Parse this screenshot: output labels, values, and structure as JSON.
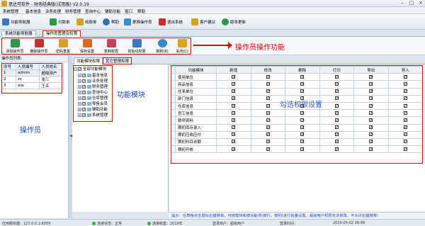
{
  "window": {
    "title": "意达可软件 - 财务经典版(试用版) V2.0.19"
  },
  "menu": [
    "系统管理",
    "基本信息",
    "业务处理",
    "财务管理",
    "查询中心",
    "辅助功能",
    "窗口",
    "帮助"
  ],
  "toolbar": [
    {
      "label": "功能导航器",
      "icon": "navigator-icon",
      "color": "#3a78c8"
    },
    {
      "label": "付款单",
      "icon": "payment-icon",
      "color": "#2d9a4a"
    },
    {
      "label": "收款单",
      "icon": "receipt-icon",
      "color": "#d8a020"
    },
    {
      "label": "帮助",
      "icon": "help-icon",
      "color": "#2f6fc0"
    },
    {
      "label": "更换操作员",
      "icon": "switch-user-icon",
      "color": "#3a8ad8"
    },
    {
      "label": "退出系统",
      "icon": "exit-icon",
      "color": "#c83030"
    },
    {
      "label": "客户建议",
      "icon": "suggestion-icon",
      "color": "#d8a020"
    },
    {
      "label": "版本更新",
      "icon": "update-icon",
      "color": "#2d9a4a"
    }
  ],
  "doc_tabs": [
    "系统功能导航器",
    "操作员管理及权限"
  ],
  "op_buttons": [
    {
      "label": "添加操作员",
      "icon": "add-user-icon",
      "color": "#2d9a4a"
    },
    {
      "label": "删除操作员",
      "icon": "delete-user-icon",
      "color": "#c83030"
    },
    {
      "label": "密码重置",
      "icon": "key-icon",
      "color": "#d8a020"
    },
    {
      "label": "保存设置",
      "icon": "save-icon",
      "color": "#d86a20"
    },
    {
      "label": "复制权限",
      "icon": "copy-permission-icon",
      "color": "#c84060"
    },
    {
      "label": "初始化权限",
      "icon": "init-permission-icon",
      "color": "#3a78c8"
    },
    {
      "label": "刷新(R)",
      "icon": "refresh-icon",
      "color": "#2f8ad0"
    },
    {
      "label": "关闭(C)",
      "icon": "close-icon",
      "color": "#e0a020"
    }
  ],
  "annotations": {
    "op_features": "操作员操作功能",
    "operators": "操作员",
    "modules": "功能模块",
    "permissions": "勾选权限设置"
  },
  "operators": {
    "caption": "操作员列表:",
    "headers": [
      "序号",
      "人员编号",
      "人员姓名"
    ],
    "rows": [
      [
        "1",
        "admin",
        "超级用户"
      ],
      [
        "2",
        "zs",
        "张三"
      ],
      [
        "3",
        "ww",
        "王五"
      ]
    ]
  },
  "module_tabs": [
    "功能模块权限",
    "其它管理权限"
  ],
  "tree": {
    "root": "全部功能模块",
    "children": [
      "基本信息",
      "业务处理",
      "财务管理",
      "查询中心",
      "仓库管理",
      "零售会员",
      "辅助功能",
      "系统管理"
    ]
  },
  "permissions": {
    "headers": [
      "功能模块",
      "新增",
      "修改",
      "删除",
      "打印",
      "导出",
      "导入"
    ],
    "rows": [
      "使用单位",
      "商品信息",
      "往来单位",
      "部门信息",
      "仓库信息",
      "员工信息",
      "款项资料",
      "期初库存录入",
      "期初应收应付",
      "期初科目余额",
      "期初开帐"
    ]
  },
  "hint": "提示：在表格点击鼠标右键菜单，可按模块和按功能项(按行，按列)进行批量设置。超级用户权限无法修改，不允许右键菜单!",
  "status": {
    "server": "应用服务器：127.0.0.1:8059",
    "connection": "连接状态：正常",
    "company": "连接帐套：2019年",
    "user": "登录用户：超级用户",
    "time_label": "登录时间：",
    "time": "2019-05-02 09:08"
  }
}
